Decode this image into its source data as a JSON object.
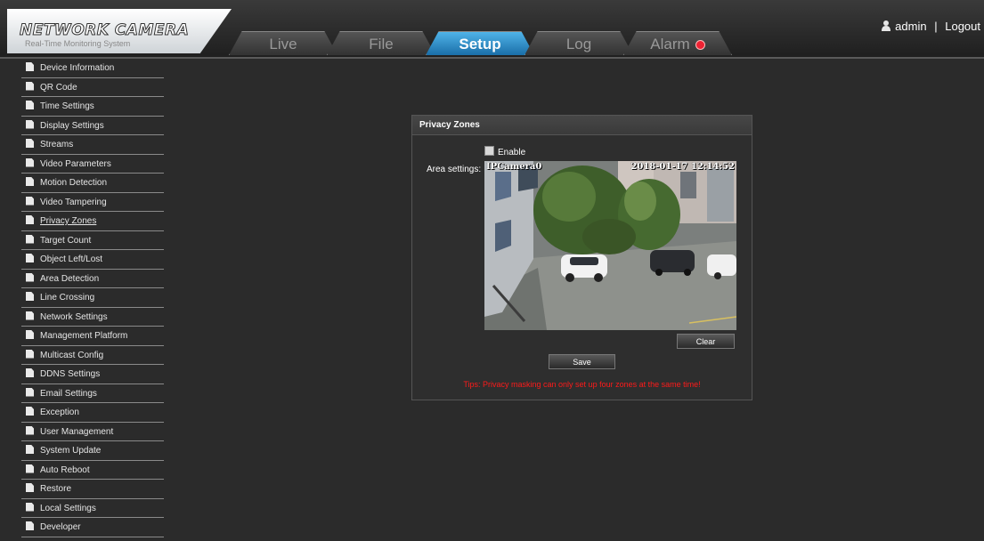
{
  "header": {
    "logo_title": "NETWORK CAMERA",
    "logo_subtitle": "Real-Time Monitoring System",
    "tabs": [
      {
        "label": "Live"
      },
      {
        "label": "File"
      },
      {
        "label": "Setup"
      },
      {
        "label": "Log"
      },
      {
        "label": "Alarm"
      }
    ],
    "active_tab": "Setup",
    "user": "admin",
    "separator": "|",
    "logout": "Logout"
  },
  "sidebar": {
    "items": [
      {
        "label": "Device Information"
      },
      {
        "label": "QR Code"
      },
      {
        "label": "Time Settings"
      },
      {
        "label": "Display Settings"
      },
      {
        "label": "Streams"
      },
      {
        "label": "Video Parameters"
      },
      {
        "label": "Motion Detection"
      },
      {
        "label": "Video Tampering"
      },
      {
        "label": "Privacy Zones"
      },
      {
        "label": "Target Count"
      },
      {
        "label": "Object Left/Lost"
      },
      {
        "label": "Area Detection"
      },
      {
        "label": "Line Crossing"
      },
      {
        "label": "Network Settings"
      },
      {
        "label": "Management Platform"
      },
      {
        "label": "Multicast Config"
      },
      {
        "label": "DDNS Settings"
      },
      {
        "label": "Email Settings"
      },
      {
        "label": "Exception"
      },
      {
        "label": "User Management"
      },
      {
        "label": "System Update"
      },
      {
        "label": "Auto Reboot"
      },
      {
        "label": "Restore"
      },
      {
        "label": "Local Settings"
      },
      {
        "label": "Developer"
      }
    ],
    "active_item": "Privacy Zones"
  },
  "panel": {
    "title": "Privacy Zones",
    "enable_label": "Enable",
    "enable_checked": false,
    "area_label": "Area settings:",
    "video_osd_name": "IPCamera0",
    "video_osd_time": "2018-01-17 12:14:52",
    "clear_label": "Clear",
    "save_label": "Save",
    "tips": "Tips: Privacy masking can only set up four zones at the same time!"
  },
  "colors": {
    "active_tab": "#2a8fd0",
    "tips": "#ff1a1a",
    "alarm": "#e22233"
  }
}
